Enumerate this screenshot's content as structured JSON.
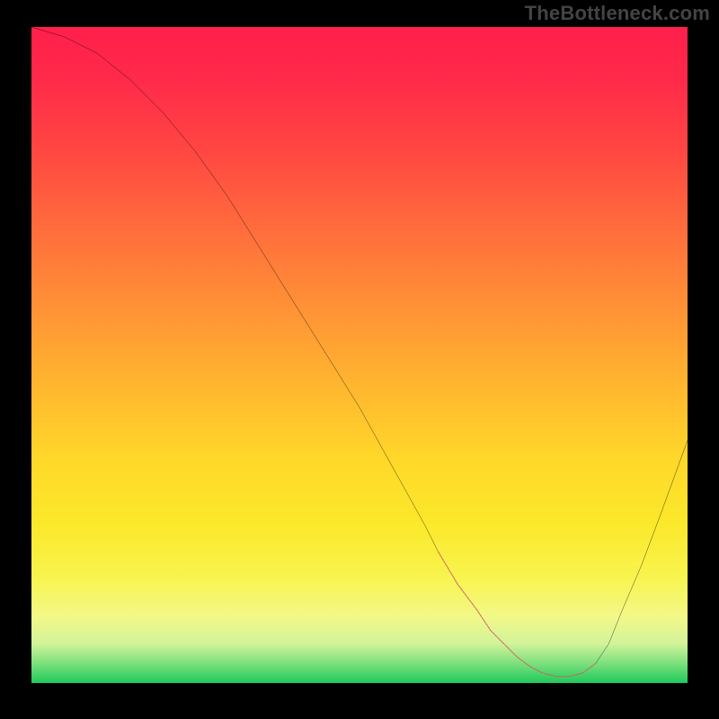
{
  "watermark": "TheBottleneck.com",
  "chart_data": {
    "type": "line",
    "title": "",
    "xlabel": "",
    "ylabel": "",
    "xlim": [
      0,
      100
    ],
    "ylim": [
      0,
      100
    ],
    "series": [
      {
        "name": "bottleneck-curve",
        "x": [
          0,
          5,
          10,
          15,
          20,
          25,
          30,
          35,
          40,
          45,
          50,
          55,
          60,
          62,
          65,
          68,
          70,
          72,
          74,
          76,
          78,
          80,
          82,
          84,
          86,
          88,
          90,
          93,
          96,
          100
        ],
        "y": [
          100,
          98.5,
          96,
          92,
          87,
          81,
          74,
          66,
          58,
          50,
          42,
          33,
          24,
          20,
          15,
          11,
          8,
          6,
          4,
          2.5,
          1.5,
          1,
          1,
          1.5,
          3,
          6,
          11,
          18,
          26,
          37
        ],
        "color": "#000000"
      },
      {
        "name": "optimal-highlight",
        "x": [
          62,
          65,
          68,
          70,
          72,
          74,
          76,
          78,
          80,
          82,
          84,
          86
        ],
        "y": [
          20,
          15,
          11,
          8,
          6,
          4,
          2.5,
          1.5,
          1,
          1,
          1.5,
          3
        ],
        "color": "#d46d6c"
      }
    ],
    "gradient_stops": [
      {
        "pos": 0.0,
        "color": "#ff1f4b"
      },
      {
        "pos": 0.18,
        "color": "#ff4443"
      },
      {
        "pos": 0.42,
        "color": "#ff8f36"
      },
      {
        "pos": 0.66,
        "color": "#ffd829"
      },
      {
        "pos": 0.84,
        "color": "#f8f44f"
      },
      {
        "pos": 0.94,
        "color": "#d2f39a"
      },
      {
        "pos": 1.0,
        "color": "#1fc95c"
      }
    ]
  }
}
